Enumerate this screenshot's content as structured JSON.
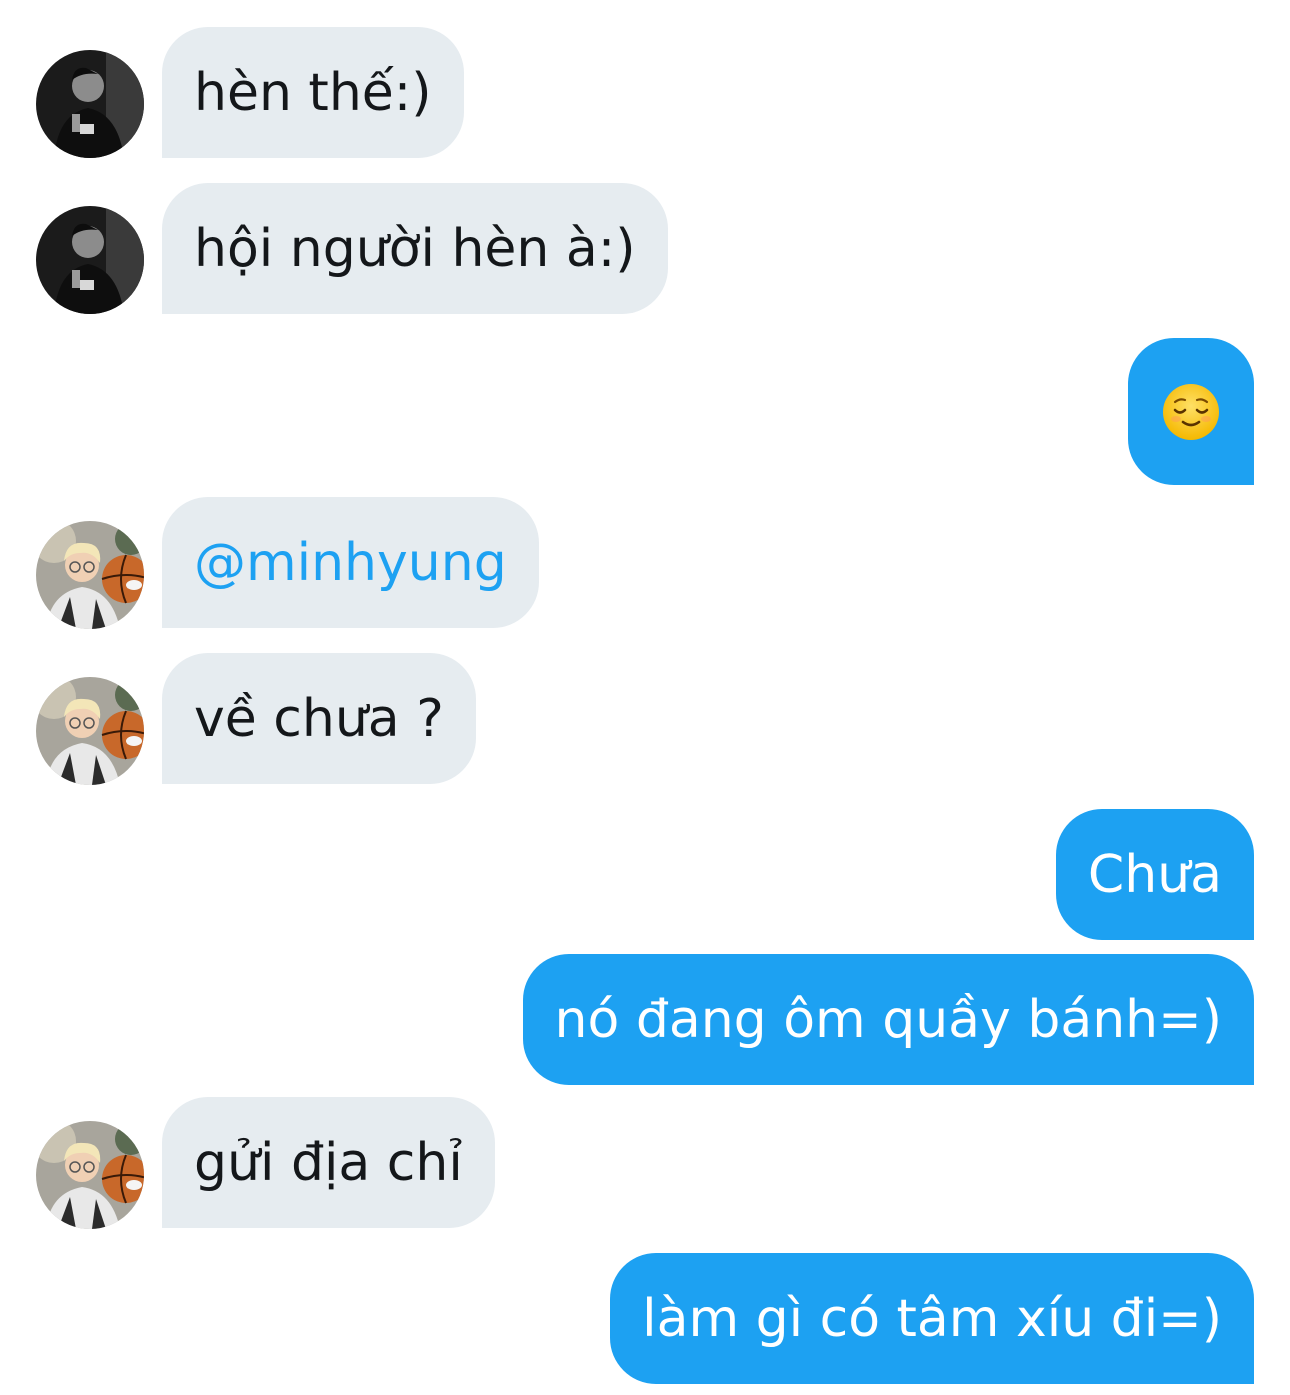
{
  "colors": {
    "incoming_bubble": "#e6ecf0",
    "outgoing_bubble": "#1da1f2",
    "mention": "#1da1f2"
  },
  "messages": [
    {
      "side": "in",
      "sender_avatar": "avatar-dark-jersey",
      "text": "hèn thế:)"
    },
    {
      "side": "in",
      "sender_avatar": "avatar-dark-jersey",
      "text": "hội người hèn à:)"
    },
    {
      "side": "out",
      "emoji": "relieved-face-emoji"
    },
    {
      "side": "in",
      "sender_avatar": "avatar-blond-basketball",
      "text": "@minhyung"
    },
    {
      "side": "in",
      "sender_avatar": "avatar-blond-basketball",
      "text": "về chưa ?"
    },
    {
      "side": "out",
      "text": "Chưa"
    },
    {
      "side": "out",
      "text": "nó đang ôm quầy bánh=)"
    },
    {
      "side": "in",
      "sender_avatar": "avatar-blond-basketball",
      "text": "gửi địa chỉ"
    },
    {
      "side": "out",
      "text": "làm gì có tâm xíu đi=)"
    }
  ]
}
